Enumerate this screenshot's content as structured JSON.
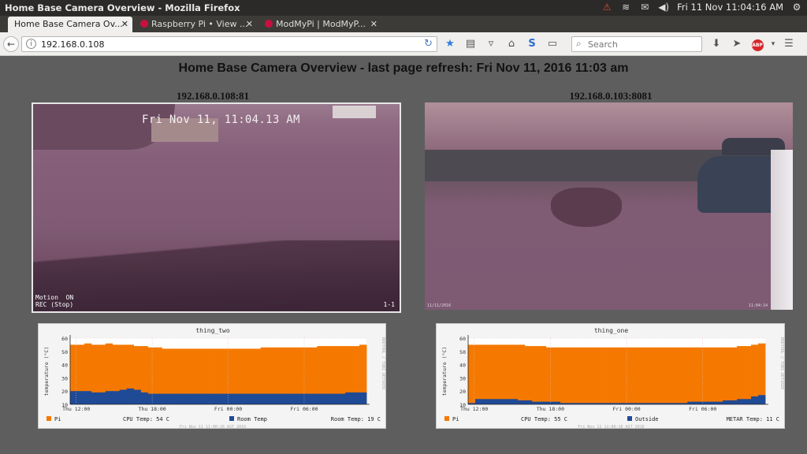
{
  "window": {
    "title": "Home Base Camera Overview - Mozilla Firefox"
  },
  "tray": {
    "datetime": "Fri 11 Nov 11:04:16 AM"
  },
  "tabs": [
    {
      "label": "Home Base Camera Ov...",
      "active": true
    },
    {
      "label": "Raspberry Pi • View ..."
    },
    {
      "label": "ModMyPi | ModMyP..."
    }
  ],
  "nav": {
    "url": "192.168.0.108",
    "search_placeholder": "Search"
  },
  "page": {
    "title": "Home Base Camera Overview - last page refresh: Fri Nov 11, 2016 11:03 am",
    "cams": [
      {
        "label": "192.168.0.108:81",
        "timestamp": "Fri Nov 11, 11:04.13 AM",
        "motion": "Motion  ON\nREC (Stop)",
        "frame": "1-1"
      },
      {
        "label": "192.168.0.103:8081",
        "small_ts": "11/11/2016",
        "small_ts2": "11:04:14"
      }
    ]
  },
  "chart_data": [
    {
      "type": "area",
      "title": "thing_two",
      "ylabel": "temperature (°C)",
      "ylim": [
        10,
        60
      ],
      "yticks": [
        10,
        20,
        30,
        40,
        50,
        60
      ],
      "xticks": [
        "Thu 12:00",
        "Thu 18:00",
        "Fri 00:00",
        "Fri 06:00"
      ],
      "side_label": "RRDTOOL / TOBI OETIKER",
      "series": [
        {
          "name": "Pi",
          "color": "#f57900",
          "values": [
            55,
            55,
            56,
            55,
            55,
            56,
            55,
            55,
            55,
            54,
            54,
            53,
            53,
            52,
            52,
            52,
            52,
            52,
            52,
            52,
            52,
            52,
            52,
            52,
            52,
            52,
            52,
            53,
            53,
            53,
            53,
            53,
            53,
            53,
            53,
            54,
            54,
            54,
            54,
            54,
            54,
            55
          ]
        },
        {
          "name": "Room Temp",
          "color": "#1f4a96",
          "values": [
            20,
            20,
            20,
            19,
            19,
            20,
            20,
            21,
            22,
            21,
            19,
            18,
            18,
            18,
            18,
            18,
            18,
            18,
            18,
            18,
            18,
            18,
            18,
            18,
            18,
            18,
            18,
            18,
            18,
            18,
            18,
            18,
            18,
            18,
            18,
            18,
            18,
            18,
            18,
            19,
            19,
            19
          ]
        }
      ],
      "legend": {
        "pi_label": "Pi",
        "cpu_temp": "CPU Temp: 54 C",
        "other_label": "Room Temp",
        "other_temp": "Room Temp: 19 C"
      },
      "footer": "Fri Nov 11 11:00:16 AST 2016"
    },
    {
      "type": "area",
      "title": "thing_one",
      "ylabel": "temperature (°C)",
      "ylim": [
        10,
        60
      ],
      "yticks": [
        10,
        20,
        30,
        40,
        50,
        60
      ],
      "xticks": [
        "Thu 12:00",
        "Thu 18:00",
        "Fri 00:00",
        "Fri 06:00"
      ],
      "side_label": "RRDTOOL / TOBI OETIKER",
      "series": [
        {
          "name": "Pi",
          "color": "#f57900",
          "values": [
            55,
            55,
            55,
            55,
            55,
            55,
            55,
            55,
            54,
            54,
            54,
            53,
            53,
            53,
            53,
            53,
            53,
            53,
            53,
            53,
            53,
            53,
            53,
            53,
            53,
            53,
            53,
            53,
            53,
            53,
            53,
            53,
            53,
            53,
            53,
            53,
            53,
            53,
            54,
            54,
            55,
            56
          ]
        },
        {
          "name": "Outside",
          "color": "#1f4a96",
          "values": [
            11,
            14,
            14,
            14,
            14,
            14,
            14,
            13,
            13,
            12,
            12,
            12,
            12,
            11,
            11,
            11,
            11,
            11,
            11,
            11,
            11,
            11,
            11,
            11,
            11,
            11,
            11,
            11,
            11,
            11,
            11,
            12,
            12,
            12,
            12,
            12,
            13,
            13,
            14,
            14,
            16,
            17
          ]
        }
      ],
      "legend": {
        "pi_label": "Pi",
        "cpu_temp": "CPU Temp: 55 C",
        "other_label": "Outside",
        "other_temp": "METAR Temp: 11 C"
      },
      "footer": "Fri Nov 11 11:00:16 AST 2016"
    }
  ]
}
